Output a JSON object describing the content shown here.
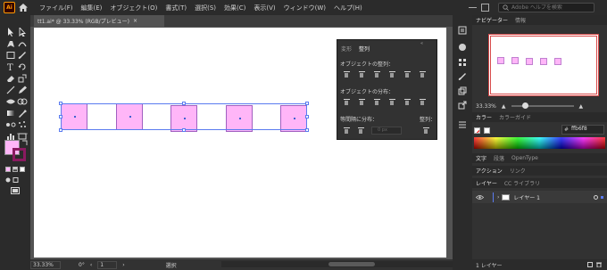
{
  "app": {
    "logo": "Ai"
  },
  "menu": [
    "ファイル(F)",
    "編集(E)",
    "オブジェクト(O)",
    "書式(T)",
    "選択(S)",
    "効果(C)",
    "表示(V)",
    "ウィンドウ(W)",
    "ヘルプ(H)"
  ],
  "search": {
    "placeholder": "Adobe ヘルプを検索"
  },
  "document": {
    "tab_label": "tt1.ai* @ 33.33% (RGB/プレビュー)",
    "close": "×"
  },
  "status": {
    "zoom": "33.33%",
    "rotate": "0°",
    "page": "1",
    "tool": "選択"
  },
  "align_panel": {
    "tabs": [
      {
        "label": "変形",
        "active": false
      },
      {
        "label": "整列",
        "active": true
      }
    ],
    "section_align_objects": "オブジェクトの整列：",
    "section_distribute_objects": "オブジェクトの分布：",
    "section_distribute_spacing": "等間隔に分布：",
    "section_align_to": "整列：",
    "spacing_value": "0 px"
  },
  "right_panel": {
    "nav_tabs": [
      {
        "label": "ナビゲーター",
        "active": true
      },
      {
        "label": "情報",
        "active": false
      }
    ],
    "nav_zoom": "33.33%",
    "color_tabs": [
      {
        "label": "カラー",
        "active": true
      },
      {
        "label": "カラーガイド",
        "active": false
      }
    ],
    "hex_prefix": "#",
    "hex_value": "ffb6f8",
    "text_tabs": [
      {
        "label": "文字",
        "active": true
      },
      {
        "label": "段落",
        "active": false
      },
      {
        "label": "OpenType",
        "active": false
      }
    ],
    "action_tabs": [
      {
        "label": "アクション",
        "active": true
      },
      {
        "label": "リンク",
        "active": false
      }
    ],
    "layer_tabs": [
      {
        "label": "レイヤー",
        "active": true
      },
      {
        "label": "CC ライブラリ",
        "active": false
      }
    ],
    "layer_name": "レイヤー 1",
    "layer_count": "1 レイヤー"
  },
  "colors": {
    "fill": "#ffb6f8",
    "accent": "#ff9a00",
    "selection": "#5a7bf0"
  },
  "icons": [
    "home-icon",
    "selection-tool-icon",
    "direct-selection-icon",
    "pen-tool-icon",
    "curvature-tool-icon",
    "type-tool-icon",
    "line-tool-icon",
    "rectangle-tool-icon",
    "paintbrush-icon",
    "pencil-icon",
    "eraser-icon",
    "rotate-icon",
    "scale-icon",
    "width-icon",
    "shape-builder-icon",
    "gradient-icon",
    "eyedropper-icon",
    "blend-icon",
    "symbol-sprayer-icon",
    "graph-icon",
    "artboard-icon",
    "slice-icon",
    "hand-icon",
    "zoom-icon",
    "fill-swatch-icon",
    "stroke-swatch-icon",
    "swap-icon",
    "screen-mode-icon",
    "visibility-eye-icon",
    "search-icon"
  ]
}
